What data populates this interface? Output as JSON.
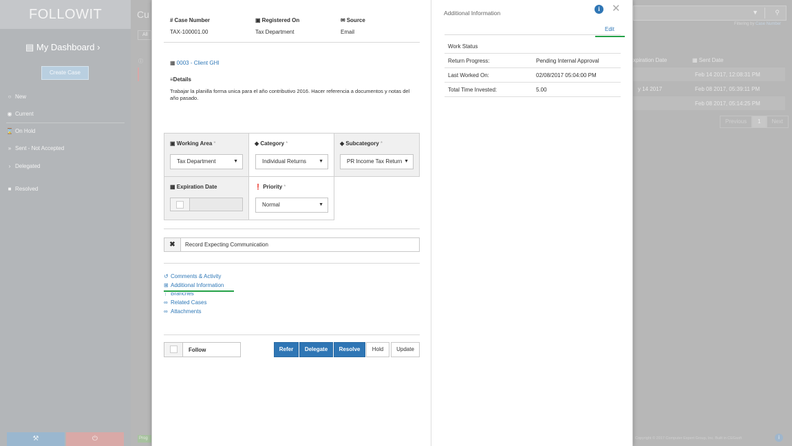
{
  "sidebar": {
    "logo": "FOLLOWIT",
    "dashboard_title": "My Dashboard",
    "create_case": "Create Case",
    "items": [
      {
        "label": "New",
        "icon": "circle-icon"
      },
      {
        "label": "Current",
        "icon": "circle-check-icon"
      },
      {
        "label": "On Hold",
        "icon": "hourglass-icon"
      },
      {
        "label": "Sent - Not Accepted",
        "icon": "chevron-right-icon"
      },
      {
        "label": "Delegated",
        "icon": "chevron-right-icon"
      },
      {
        "label": "Resolved",
        "icon": "square-icon"
      }
    ]
  },
  "background": {
    "page_title_fragment": "Cu",
    "all_tab": "All",
    "filtering_text": "Filtering by",
    "filtering_value": "Case Number",
    "col_expiration": "xpiration Date",
    "col_sent": "Sent Date",
    "rows": [
      {
        "expiration": "",
        "sent": "Feb 14 2017, 12:08:31 PM"
      },
      {
        "expiration": "y 14 2017",
        "sent": "Feb 08 2017, 05:39:11 PM"
      },
      {
        "expiration": "",
        "sent": "Feb 08 2017, 05:14:25 PM"
      }
    ],
    "pager": {
      "previous": "Previous",
      "page": "1",
      "next": "Next"
    },
    "footer": "Copyright © 2017 Computer Expert Group, Inc. Built in CEGsoft",
    "status_chip": "Prog"
  },
  "case": {
    "case_number_label": "Case Number",
    "case_number": "TAX-100001.00",
    "registered_on_label": "Registered On",
    "registered_on": "Tax Department",
    "source_label": "Source",
    "source": "Email",
    "client_link": "0003 - Client GHI",
    "details_label": "Details",
    "details_text": "Trabajar la planilla forma unica para el año contributivo 2016. Hacer referencia a documentos y notas del año pasado.",
    "working_area_label": "Working Area",
    "working_area": "Tax Department",
    "category_label": "Category",
    "category": "Individual Returns",
    "subcategory_label": "Subcategory",
    "subcategory": "PR Income Tax Return",
    "expiration_label": "Expiration Date",
    "priority_label": "Priority",
    "priority": "Normal",
    "required_mark": "*",
    "record_text": "Record Expecting Communication",
    "links": [
      {
        "label": "Comments & Activity",
        "icon": "history-icon"
      },
      {
        "label": "Additional Information",
        "icon": "plus-square-icon"
      },
      {
        "label": "Branches",
        "icon": "branch-icon"
      },
      {
        "label": "Related Cases",
        "icon": "link-icon"
      },
      {
        "label": "Attachments",
        "icon": "paperclip-icon"
      }
    ],
    "follow_label": "Follow",
    "buttons": {
      "refer": "Refer",
      "delegate": "Delegate",
      "resolve": "Resolve",
      "hold": "Hold",
      "update": "Update"
    }
  },
  "additional_info": {
    "title": "Additional Information",
    "edit": "Edit",
    "rows": [
      {
        "key": "Work Status",
        "value": ""
      },
      {
        "key": "Return Progress:",
        "value": "Pending Internal Approval"
      },
      {
        "key": "Last Worked On:",
        "value": "02/08/2017 05:04:00 PM"
      },
      {
        "key": "Total Time Invested:",
        "value": "5.00"
      }
    ]
  },
  "colors": {
    "primary": "#2f76b5",
    "link": "#2f78b7",
    "active_underline": "#23a147"
  }
}
